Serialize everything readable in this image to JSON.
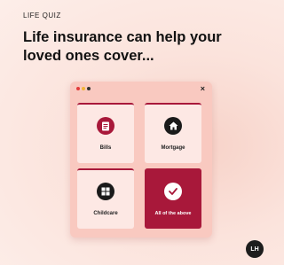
{
  "eyebrow": "LIFE QUIZ",
  "headline": "Life insurance can help your loved ones cover...",
  "window": {
    "close_label": "×",
    "dot_colors": [
      "#e23b3b",
      "#f3b437",
      "#333333"
    ]
  },
  "options": [
    {
      "label": "Bills",
      "icon": "document-icon",
      "selected": false
    },
    {
      "label": "Mortgage",
      "icon": "home-icon",
      "selected": false
    },
    {
      "label": "Childcare",
      "icon": "blocks-icon",
      "selected": false
    },
    {
      "label": "All of the above",
      "icon": "check-icon",
      "selected": true
    }
  ],
  "logo_text": "LH",
  "colors": {
    "accent": "#a8183a",
    "panel": "#f9c9c0",
    "card": "#fde8e4",
    "background": "#fbe3dc"
  }
}
